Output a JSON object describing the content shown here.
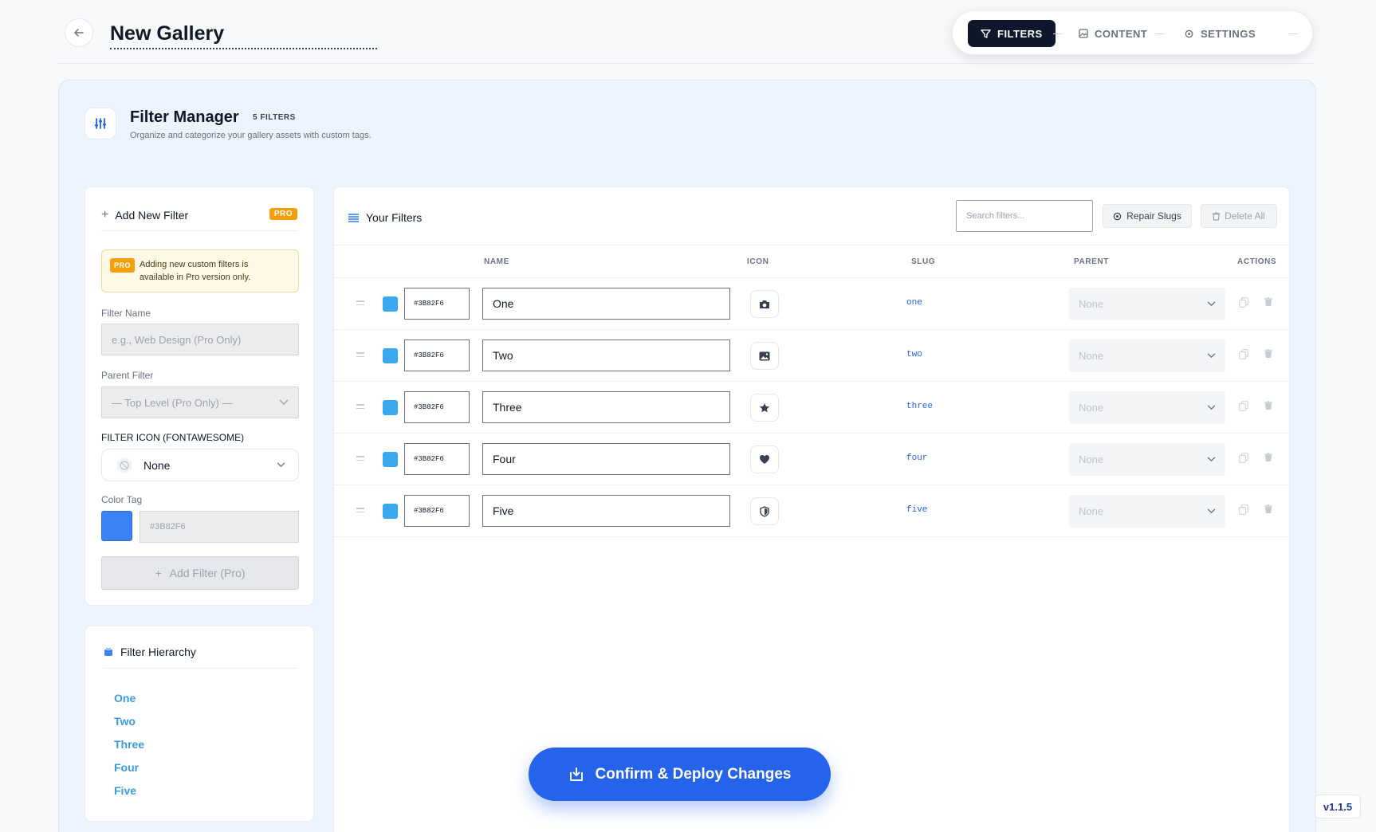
{
  "header": {
    "title": "New Gallery",
    "tabs": [
      {
        "label": "FILTERS",
        "icon": "filter-icon",
        "active": true
      },
      {
        "label": "CONTENT",
        "icon": "image-icon",
        "active": false
      },
      {
        "label": "SETTINGS",
        "icon": "gear-icon",
        "active": false
      }
    ]
  },
  "filter_manager": {
    "title": "Filter Manager",
    "count_badge": "5 FILTERS",
    "subtitle": "Organize and categorize your gallery assets with custom tags."
  },
  "add_filter": {
    "title": "Add New Filter",
    "pro_badge": "PRO",
    "notice_badge": "PRO",
    "notice_text": "Adding new custom filters is available in Pro version only.",
    "name_label": "Filter Name",
    "name_placeholder": "e.g., Web Design (Pro Only)",
    "parent_label": "Parent Filter",
    "parent_value": "— Top Level (Pro Only) —",
    "icon_label": "FILTER ICON (FONTAWESOME)",
    "icon_value": "None",
    "color_label": "Color Tag",
    "color_value": "#3B82F6",
    "button_label": "Add Filter (Pro)"
  },
  "hierarchy": {
    "title": "Filter Hierarchy",
    "items": [
      "One",
      "Two",
      "Three",
      "Four",
      "Five"
    ]
  },
  "filters_table": {
    "title": "Your Filters",
    "search_placeholder": "Search filters...",
    "repair_label": "Repair Slugs",
    "delete_all_label": "Delete All",
    "columns": {
      "name": "NAME",
      "icon": "ICON",
      "slug": "SLUG",
      "parent": "PARENT",
      "actions": "ACTIONS"
    },
    "rows": [
      {
        "color": "#3B82F6",
        "name": "One",
        "icon": "camera-icon",
        "slug": "one",
        "parent": "None"
      },
      {
        "color": "#3B82F6",
        "name": "Two",
        "icon": "image-icon",
        "slug": "two",
        "parent": "None"
      },
      {
        "color": "#3B82F6",
        "name": "Three",
        "icon": "star-icon",
        "slug": "three",
        "parent": "None"
      },
      {
        "color": "#3B82F6",
        "name": "Four",
        "icon": "heart-icon",
        "slug": "four",
        "parent": "None"
      },
      {
        "color": "#3B82F6",
        "name": "Five",
        "icon": "shield-icon",
        "slug": "five",
        "parent": "None"
      }
    ]
  },
  "deploy_button": "Confirm & Deploy Changes",
  "version": "v1.1.5",
  "colors": {
    "accent": "#2563eb",
    "pro": "#f59e0b",
    "swatch": "#3aa8f0",
    "dark": "#0f172a"
  }
}
